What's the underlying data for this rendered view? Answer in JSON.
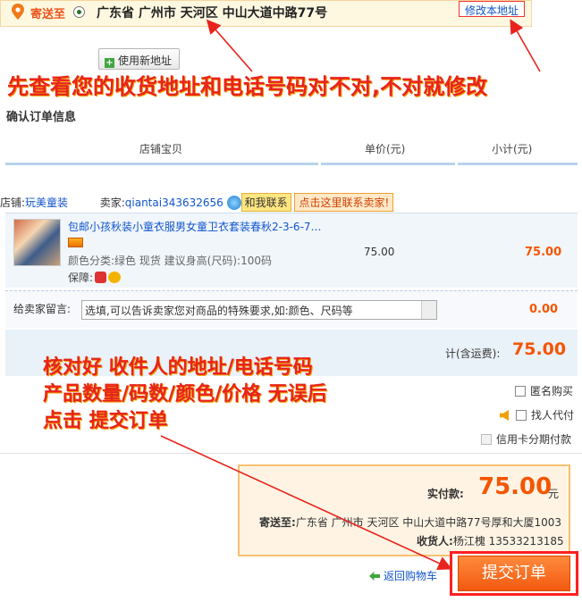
{
  "address": {
    "ship_to_label": "寄送至",
    "text": "广东省 广州市 天河区 中山大道中路77号",
    "edit_label": "修改本地址",
    "new_address_label": "使用新地址"
  },
  "annotations": {
    "top": "先查看您的收货地址和电话号码对不对,不对就修改",
    "middle": "核对好 收件人的地址/电话号码\n产品数量/码数/颜色/价格 无误后\n点击 提交订单"
  },
  "section_title": "确认订单信息",
  "table_headers": {
    "item": "店铺宝贝",
    "unit_price": "单价(元)",
    "subtotal": "小计(元)"
  },
  "shop": {
    "shop_label": "店铺:",
    "shop_name": "玩美童装",
    "seller_label": "卖家:",
    "seller_name": "qiantai343632656",
    "chat_label": "和我联系",
    "contact_label": "点击这里联系卖家!"
  },
  "item": {
    "title": "包邮小孩秋装小童衣服男女童卫衣套装春秋2-3-6-7…",
    "attributes": "颜色分类:绿色 现货   建议身高(尺码):100码",
    "guarantee_label": "保障:",
    "unit_price": "75.00",
    "subtotal": "75.00"
  },
  "message": {
    "label": "给卖家留言:",
    "value": "选填,可以告诉卖家您对商品的特殊要求,如:颜色、尺码等",
    "fee": "0.00"
  },
  "total": {
    "label": "计(含运费):",
    "value": "75.00"
  },
  "options": {
    "anonymous": "匿名购买",
    "proxy_pay": "找人代付",
    "installment": "信用卡分期付款"
  },
  "summary": {
    "pay_label": "实付款:",
    "pay_value": "75.00",
    "pay_unit": "元",
    "ship_label": "寄送至:",
    "ship_value": "广东省 广州市 天河区 中山大道中路77号厚和大厦1003",
    "receiver_label": "收货人:",
    "receiver_value": "杨江槐 13533213185"
  },
  "actions": {
    "back_label": "返回购物车",
    "submit_label": "提交订单"
  },
  "colors": {
    "accent": "#f55500",
    "annotation": "#e8231c",
    "link": "#1155cc"
  }
}
